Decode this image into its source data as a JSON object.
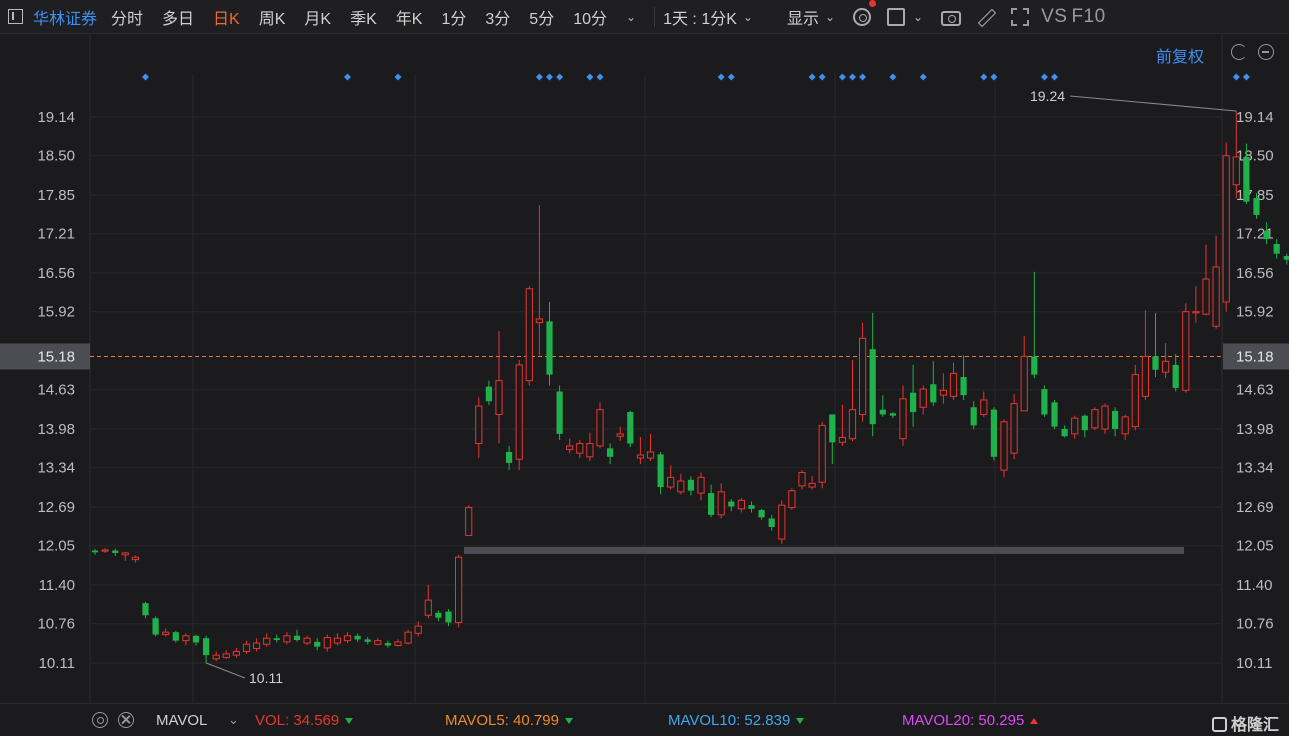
{
  "toolbar": {
    "stock_name": "华林证券",
    "periods": [
      "分时",
      "多日",
      "日K",
      "周K",
      "月K",
      "季K",
      "年K",
      "1分",
      "3分",
      "5分",
      "10分"
    ],
    "active_period": "日K",
    "interval_select": "1天 : 1分K",
    "display_label": "显示",
    "vs_label": "VS",
    "f10_label": "F10"
  },
  "adjust_label": "前复权",
  "chart_data": {
    "type": "candlestick",
    "y_ticks": [
      "19.14",
      "18.50",
      "17.85",
      "17.21",
      "16.56",
      "15.92",
      "15.18",
      "14.63",
      "13.98",
      "13.34",
      "12.69",
      "12.05",
      "11.40",
      "10.76",
      "10.11"
    ],
    "current_price": 15.18,
    "annotations": {
      "high": "19.24",
      "low": "10.11"
    },
    "up_color": "#e8352e",
    "down_color": "#1fb24a",
    "grid": true,
    "candles": [
      [
        11.97,
        11.94,
        12.0,
        11.9
      ],
      [
        11.97,
        11.98,
        12.01,
        11.93
      ],
      [
        11.97,
        11.93,
        12.0,
        11.88
      ],
      [
        11.9,
        11.93,
        11.95,
        11.8
      ],
      [
        11.82,
        11.86,
        11.89,
        11.77
      ],
      [
        11.1,
        10.9,
        11.12,
        10.85
      ],
      [
        10.85,
        10.58,
        10.88,
        10.55
      ],
      [
        10.58,
        10.62,
        10.68,
        10.55
      ],
      [
        10.62,
        10.48,
        10.64,
        10.45
      ],
      [
        10.48,
        10.56,
        10.6,
        10.4
      ],
      [
        10.56,
        10.45,
        10.58,
        10.4
      ],
      [
        10.52,
        10.24,
        10.56,
        10.11
      ],
      [
        10.18,
        10.24,
        10.3,
        10.14
      ],
      [
        10.2,
        10.26,
        10.32,
        10.18
      ],
      [
        10.24,
        10.3,
        10.36,
        10.2
      ],
      [
        10.3,
        10.42,
        10.48,
        10.26
      ],
      [
        10.35,
        10.44,
        10.52,
        10.3
      ],
      [
        10.42,
        10.52,
        10.6,
        10.38
      ],
      [
        10.52,
        10.49,
        10.58,
        10.45
      ],
      [
        10.46,
        10.56,
        10.62,
        10.42
      ],
      [
        10.56,
        10.49,
        10.66,
        10.46
      ],
      [
        10.44,
        10.52,
        10.56,
        10.4
      ],
      [
        10.46,
        10.38,
        10.52,
        10.32
      ],
      [
        10.36,
        10.53,
        10.58,
        10.3
      ],
      [
        10.44,
        10.52,
        10.6,
        10.4
      ],
      [
        10.48,
        10.56,
        10.62,
        10.44
      ],
      [
        10.56,
        10.5,
        10.6,
        10.46
      ],
      [
        10.5,
        10.46,
        10.54,
        10.42
      ],
      [
        10.42,
        10.48,
        10.52,
        10.4
      ],
      [
        10.44,
        10.4,
        10.48,
        10.36
      ],
      [
        10.4,
        10.46,
        10.5,
        10.38
      ],
      [
        10.44,
        10.62,
        10.66,
        10.42
      ],
      [
        10.6,
        10.72,
        10.8,
        10.55
      ],
      [
        10.9,
        11.15,
        11.4,
        10.85
      ],
      [
        10.94,
        10.86,
        10.98,
        10.8
      ],
      [
        10.96,
        10.78,
        11.0,
        10.72
      ],
      [
        10.78,
        11.86,
        11.9,
        10.7
      ],
      [
        12.22,
        12.68,
        12.72,
        12.38
      ],
      [
        13.74,
        14.36,
        14.5,
        13.5
      ],
      [
        14.68,
        14.44,
        14.78,
        14.38
      ],
      [
        14.22,
        14.78,
        15.6,
        13.74
      ],
      [
        13.6,
        13.42,
        13.7,
        13.3
      ],
      [
        13.48,
        15.04,
        15.12,
        13.3
      ],
      [
        14.78,
        16.3,
        16.34,
        14.7
      ],
      [
        15.74,
        15.8,
        17.68,
        15.2
      ],
      [
        15.76,
        14.88,
        16.08,
        14.7
      ],
      [
        14.6,
        13.9,
        14.7,
        13.8
      ],
      [
        13.64,
        13.7,
        13.82,
        13.58
      ],
      [
        13.58,
        13.74,
        13.8,
        13.5
      ],
      [
        13.52,
        13.74,
        13.92,
        13.45
      ],
      [
        13.7,
        14.3,
        14.42,
        13.66
      ],
      [
        13.66,
        13.52,
        13.74,
        13.4
      ],
      [
        13.86,
        13.9,
        14.02,
        13.78
      ],
      [
        14.26,
        13.74,
        14.28,
        13.68
      ],
      [
        13.5,
        13.55,
        13.85,
        13.4
      ],
      [
        13.5,
        13.6,
        13.9,
        13.45
      ],
      [
        13.56,
        13.02,
        13.6,
        12.9
      ],
      [
        13.02,
        13.18,
        13.38,
        12.98
      ],
      [
        12.94,
        13.12,
        13.24,
        12.9
      ],
      [
        13.14,
        12.96,
        13.2,
        12.88
      ],
      [
        12.92,
        13.18,
        13.26,
        12.8
      ],
      [
        12.92,
        12.56,
        13.06,
        12.52
      ],
      [
        12.56,
        12.94,
        13.08,
        12.5
      ],
      [
        12.78,
        12.7,
        12.82,
        12.62
      ],
      [
        12.66,
        12.8,
        12.84,
        12.6
      ],
      [
        12.72,
        12.66,
        12.78,
        12.6
      ],
      [
        12.64,
        12.52,
        12.66,
        12.48
      ],
      [
        12.5,
        12.36,
        12.56,
        12.3
      ],
      [
        12.16,
        12.72,
        12.8,
        12.08
      ],
      [
        12.68,
        12.96,
        13.0,
        12.64
      ],
      [
        13.04,
        13.26,
        13.3,
        12.98
      ],
      [
        13.02,
        13.08,
        13.2,
        12.98
      ],
      [
        13.1,
        14.04,
        14.1,
        13.0
      ],
      [
        14.22,
        13.76,
        14.22,
        13.4
      ],
      [
        13.76,
        13.84,
        14.38,
        13.7
      ],
      [
        13.82,
        14.3,
        15.12,
        13.78
      ],
      [
        14.22,
        15.48,
        15.74,
        14.1
      ],
      [
        15.3,
        14.06,
        15.9,
        13.86
      ],
      [
        14.3,
        14.22,
        14.54,
        14.18
      ],
      [
        14.24,
        14.2,
        14.26,
        14.16
      ],
      [
        13.82,
        14.48,
        14.7,
        13.7
      ],
      [
        14.58,
        14.26,
        15.04,
        14.02
      ],
      [
        14.34,
        14.64,
        14.7,
        14.22
      ],
      [
        14.72,
        14.42,
        15.1,
        14.36
      ],
      [
        14.54,
        14.62,
        14.9,
        14.4
      ],
      [
        14.52,
        14.9,
        15.08,
        14.46
      ],
      [
        14.84,
        14.54,
        15.2,
        14.46
      ],
      [
        14.34,
        14.04,
        14.44,
        13.98
      ],
      [
        14.22,
        14.46,
        14.6,
        14.18
      ],
      [
        14.3,
        13.52,
        14.34,
        13.46
      ],
      [
        13.3,
        14.1,
        14.14,
        13.18
      ],
      [
        13.58,
        14.4,
        14.56,
        13.48
      ],
      [
        14.28,
        15.18,
        15.52,
        14.3
      ],
      [
        15.18,
        14.88,
        16.58,
        14.82
      ],
      [
        14.64,
        14.22,
        14.7,
        14.18
      ],
      [
        14.42,
        14.02,
        14.46,
        13.98
      ],
      [
        13.98,
        13.86,
        14.04,
        13.84
      ],
      [
        13.9,
        14.16,
        14.2,
        13.82
      ],
      [
        14.2,
        13.96,
        14.22,
        13.84
      ],
      [
        14.0,
        14.3,
        14.34,
        13.96
      ],
      [
        13.98,
        14.36,
        14.4,
        13.9
      ],
      [
        14.28,
        13.98,
        14.34,
        13.86
      ],
      [
        13.9,
        14.18,
        14.22,
        13.8
      ],
      [
        14.02,
        14.88,
        15.04,
        13.96
      ],
      [
        14.52,
        15.18,
        15.94,
        14.46
      ],
      [
        15.18,
        14.96,
        15.9,
        14.84
      ],
      [
        14.92,
        15.1,
        15.4,
        14.82
      ],
      [
        15.04,
        14.66,
        15.22,
        14.6
      ],
      [
        14.62,
        15.92,
        16.06,
        14.58
      ],
      [
        15.92,
        15.92,
        16.34,
        15.74
      ],
      [
        15.88,
        16.46,
        17.03,
        15.86
      ],
      [
        15.68,
        16.66,
        17.18,
        15.64
      ],
      [
        16.08,
        18.5,
        18.72,
        15.92
      ],
      [
        18.02,
        18.48,
        19.24,
        17.8
      ],
      [
        18.48,
        17.74,
        18.7,
        17.7
      ],
      [
        17.8,
        17.52,
        17.88,
        17.46
      ],
      [
        17.26,
        17.12,
        17.4,
        17.04
      ],
      [
        17.04,
        16.88,
        17.12,
        16.8
      ],
      [
        16.84,
        16.78,
        16.88,
        16.7
      ],
      [
        16.78,
        16.54,
        16.86,
        16.48
      ],
      [
        16.46,
        16.22,
        16.5,
        16.18
      ],
      [
        16.22,
        17.12,
        17.26,
        16.16
      ],
      [
        16.88,
        16.18,
        16.98,
        16.1
      ],
      [
        16.0,
        15.18,
        16.02,
        15.1
      ],
      [
        15.18,
        14.59,
        15.2,
        14.55
      ]
    ],
    "event_marks": [
      5,
      25,
      30,
      44,
      45,
      46,
      49,
      50,
      62,
      63,
      71,
      72,
      74,
      75,
      76,
      79,
      82,
      88,
      89,
      94,
      95,
      113,
      114
    ]
  },
  "indicators": {
    "name": "MAVOL",
    "vol": {
      "label": "VOL: 34.569",
      "color": "#e8352e",
      "trend": "down"
    },
    "mavol5": {
      "label": "MAVOL5: 40.799",
      "color": "#ef8a2a",
      "trend": "down"
    },
    "mavol10": {
      "label": "MAVOL10: 52.839",
      "color": "#3fa7f0",
      "trend": "down"
    },
    "mavol20": {
      "label": "MAVOL20: 50.295",
      "color": "#d94cf0",
      "trend": "up"
    }
  },
  "brand": "格隆汇"
}
